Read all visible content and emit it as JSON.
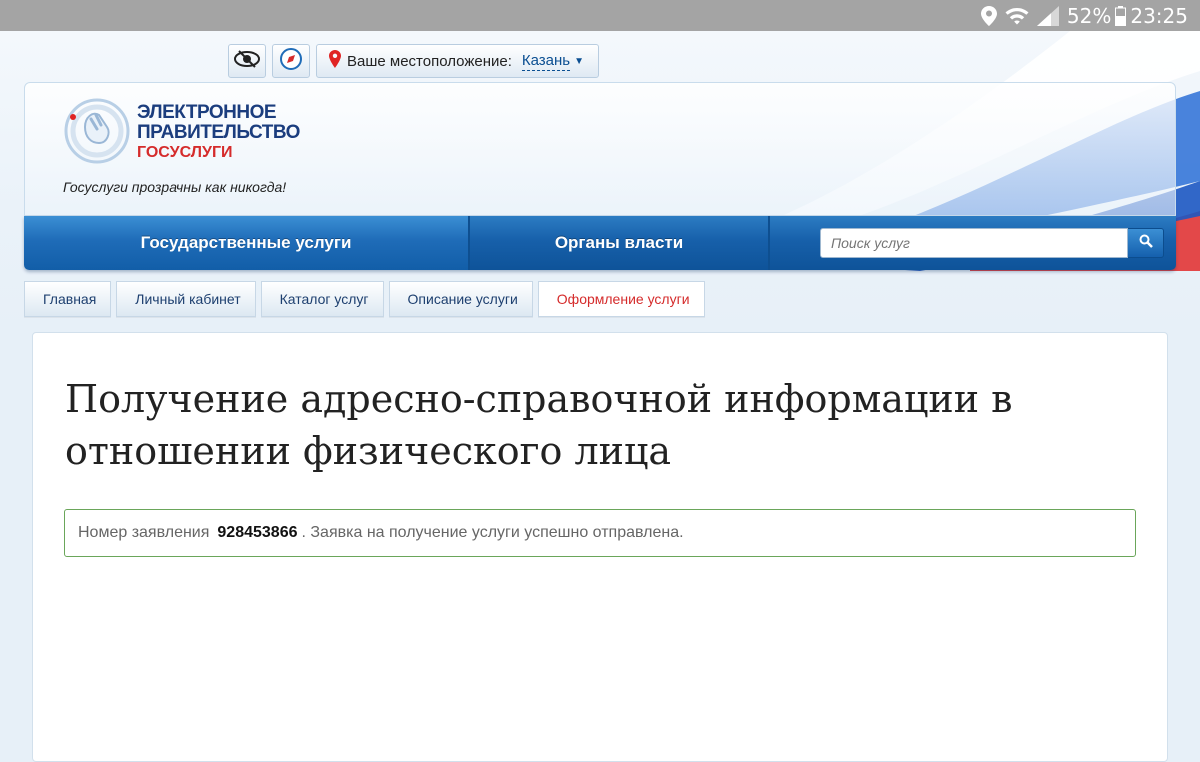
{
  "status_bar": {
    "battery_percent": "52%",
    "time": "23:25"
  },
  "utility_bar": {
    "location_label": "Ваше местоположение:",
    "location_value": "Казань"
  },
  "branding": {
    "line1": "ЭЛЕКТРОННОЕ",
    "line2": "ПРАВИТЕЛЬСТВО",
    "line3": "ГОСУСЛУГИ",
    "slogan": "Госуслуги прозрачны как никогда!"
  },
  "nav": {
    "items": [
      {
        "label": "Государственные услуги"
      },
      {
        "label": "Органы власти"
      }
    ],
    "search_placeholder": "Поиск услуг"
  },
  "breadcrumbs": [
    {
      "label": "Главная"
    },
    {
      "label": "Личный кабинет"
    },
    {
      "label": "Каталог услуг"
    },
    {
      "label": "Описание услуги"
    },
    {
      "label": "Оформление услуги"
    }
  ],
  "main": {
    "title": "Получение адресно-справочной информации в отношении физического лица",
    "alert": {
      "prefix": "Номер заявления",
      "number": "928453866",
      "suffix": ". Заявка на получение услуги успешно отправлена."
    }
  },
  "colors": {
    "brand_blue": "#1b3d7e",
    "brand_red": "#d52b2b",
    "nav_blue": "#1f6cb8",
    "success_border": "#6aa65a"
  }
}
